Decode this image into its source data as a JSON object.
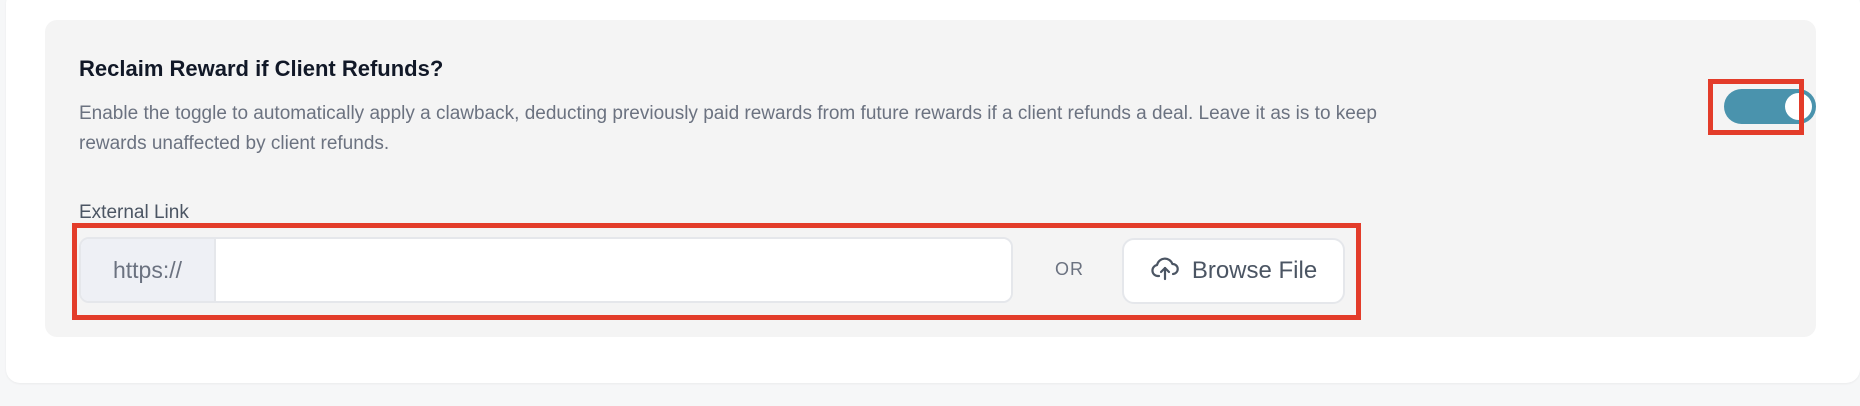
{
  "setting": {
    "title": "Reclaim Reward if Client Refunds?",
    "description": "Enable the toggle to automatically apply a clawback, deducting previously paid rewards from future rewards if a client refunds a deal. Leave it as is to keep rewards unaffected by client refunds.",
    "toggle_on": true
  },
  "external_link": {
    "label": "External Link",
    "prefix": "https://",
    "value": "",
    "placeholder": ""
  },
  "or_label": "OR",
  "browse": {
    "label": "Browse File",
    "icon": "cloud-upload-icon"
  },
  "colors": {
    "toggle_on": "#4a93ad",
    "highlight": "#e33c2a",
    "panel_bg": "#f4f4f4"
  }
}
